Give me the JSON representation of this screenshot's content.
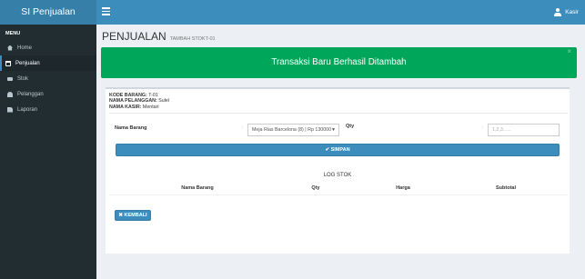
{
  "app": {
    "brand": "SI Penjualan",
    "user": "Kasir"
  },
  "sidebar": {
    "header": "MENU",
    "items": [
      {
        "label": "Home",
        "icon": "home-icon",
        "active": false
      },
      {
        "label": "Penjualan",
        "icon": "shopping-cart-icon",
        "active": true
      },
      {
        "label": "Stok",
        "icon": "truck-icon",
        "active": false
      },
      {
        "label": "Pelanggan",
        "icon": "users-icon",
        "active": false
      },
      {
        "label": "Laporan",
        "icon": "file-icon",
        "active": false
      }
    ]
  },
  "page": {
    "title": "PENJUALAN",
    "subtitle": "TAMBAH STOKT-01"
  },
  "alert": {
    "message": "Transaksi Baru Berhasil Ditambah",
    "close": "×",
    "color": "#00a65a"
  },
  "info": {
    "kode_label": "KODE BARANG:",
    "kode_value": "T-01",
    "pelanggan_label": "NAMA PELANGGAN:",
    "pelanggan_value": "Sulel",
    "kasir_label": "NAMA KASIR:",
    "kasir_value": "Mentari"
  },
  "form": {
    "nama_barang_label": "Nama Barang",
    "colon": ":",
    "select_value": "Meja Rias Barcelona (8) | Rp 130000",
    "qty_label": "Qty",
    "qty_placeholder": "1,2,3......",
    "save_label": "✔ SIMPAN"
  },
  "log": {
    "title": "LOG STOK",
    "columns": [
      "Nama Barang",
      "Qty",
      "Harga",
      "Subtotal"
    ]
  },
  "back_label": "✖ KEMBALI",
  "colors": {
    "primary": "#3c8dbc",
    "sidebar": "#222d32",
    "success": "#00a65a"
  }
}
